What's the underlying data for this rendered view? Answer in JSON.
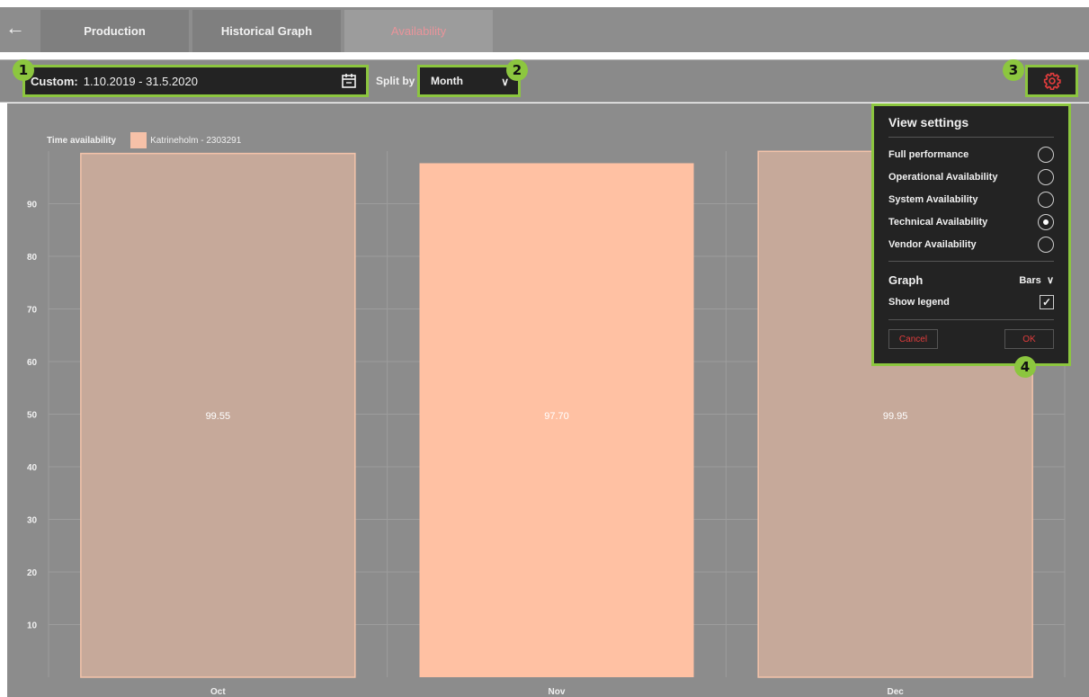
{
  "tabs": [
    {
      "label": "Production"
    },
    {
      "label": "Historical Graph"
    },
    {
      "label": "Availability"
    }
  ],
  "filter": {
    "date_label": "Custom:",
    "date_value": "1.10.2019 - 31.5.2020",
    "split_by_label": "Split by",
    "split_value": "Month"
  },
  "markers": [
    "1",
    "2",
    "3",
    "4"
  ],
  "legend": {
    "title": "Time availability",
    "series": "Katrineholm - 2303291"
  },
  "settings": {
    "title": "View settings",
    "options": [
      {
        "label": "Full performance",
        "selected": false
      },
      {
        "label": "Operational Availability",
        "selected": false
      },
      {
        "label": "System Availability",
        "selected": false
      },
      {
        "label": "Technical Availability",
        "selected": true
      },
      {
        "label": "Vendor Availability",
        "selected": false
      }
    ],
    "graph_label": "Graph",
    "graph_value": "Bars",
    "show_legend_label": "Show legend",
    "show_legend_checked": true,
    "cancel_label": "Cancel",
    "ok_label": "OK"
  },
  "colors": {
    "accent": "#8cc63f",
    "bar_fill": "#f6c1a8",
    "bar_highlight": "#ffc1a3",
    "danger": "#e03c3c"
  },
  "chart_data": {
    "type": "bar",
    "categories": [
      "Oct",
      "Nov",
      "Dec"
    ],
    "series": [
      {
        "name": "Katrineholm - 2303291",
        "values": [
          99.55,
          97.7,
          99.95
        ]
      }
    ],
    "data_labels": [
      "99.55",
      "97.70",
      "99.95"
    ],
    "y_ticks": [
      10,
      20,
      30,
      40,
      50,
      60,
      70,
      80,
      90
    ],
    "ylim": [
      0,
      100
    ],
    "grid": true
  }
}
